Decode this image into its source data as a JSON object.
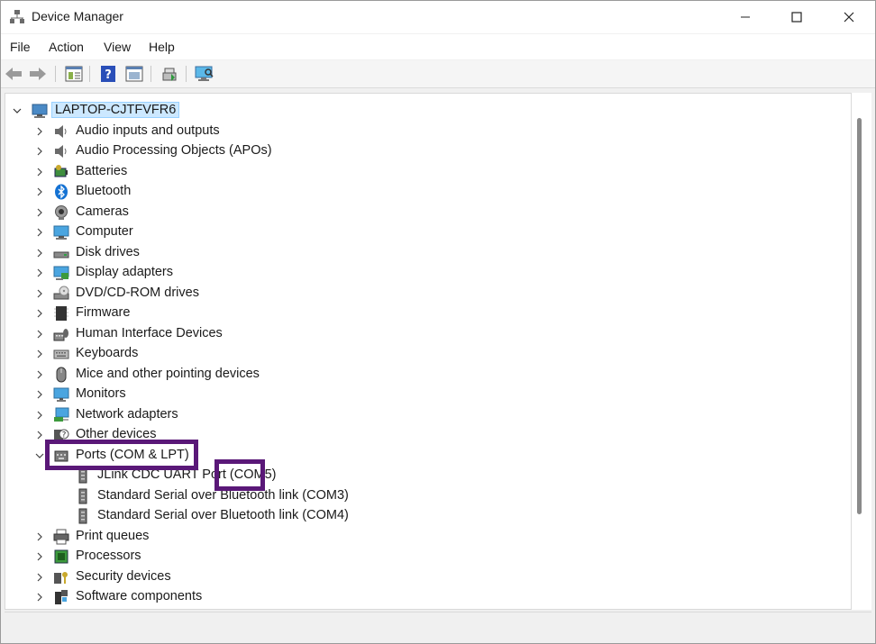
{
  "window": {
    "title": "Device Manager"
  },
  "menu": [
    "File",
    "Action",
    "View",
    "Help"
  ],
  "toolbar_icons": [
    "back-arrow-icon",
    "forward-arrow-icon",
    "properties-icon",
    "help-icon",
    "show-hidden-icon",
    "update-driver-icon",
    "scan-hardware-icon"
  ],
  "tree": {
    "root": "LAPTOP-CJTFVFR6",
    "categories": [
      {
        "label": "Audio inputs and outputs",
        "icon": "speaker-icon"
      },
      {
        "label": "Audio Processing Objects (APOs)",
        "icon": "speaker-icon"
      },
      {
        "label": "Batteries",
        "icon": "battery-icon"
      },
      {
        "label": "Bluetooth",
        "icon": "bluetooth-icon"
      },
      {
        "label": "Cameras",
        "icon": "camera-icon"
      },
      {
        "label": "Computer",
        "icon": "computer-icon"
      },
      {
        "label": "Disk drives",
        "icon": "disk-drive-icon"
      },
      {
        "label": "Display adapters",
        "icon": "display-adapter-icon"
      },
      {
        "label": "DVD/CD-ROM drives",
        "icon": "dvd-drive-icon"
      },
      {
        "label": "Firmware",
        "icon": "firmware-icon"
      },
      {
        "label": "Human Interface Devices",
        "icon": "hid-icon"
      },
      {
        "label": "Keyboards",
        "icon": "keyboard-icon"
      },
      {
        "label": "Mice and other pointing devices",
        "icon": "mouse-icon"
      },
      {
        "label": "Monitors",
        "icon": "monitor-icon"
      },
      {
        "label": "Network adapters",
        "icon": "network-adapter-icon"
      },
      {
        "label": "Other devices",
        "icon": "unknown-device-icon"
      },
      {
        "label": "Ports (COM & LPT)",
        "icon": "port-icon",
        "expanded": true,
        "children": [
          "JLink CDC UART Port (COM5)",
          "Standard Serial over Bluetooth link (COM3)",
          "Standard Serial over Bluetooth link (COM4)"
        ]
      },
      {
        "label": "Print queues",
        "icon": "printer-icon"
      },
      {
        "label": "Processors",
        "icon": "processor-icon"
      },
      {
        "label": "Security devices",
        "icon": "security-device-icon"
      },
      {
        "label": "Software components",
        "icon": "software-component-icon"
      }
    ]
  },
  "annotations": {
    "color": "#5a1878"
  }
}
